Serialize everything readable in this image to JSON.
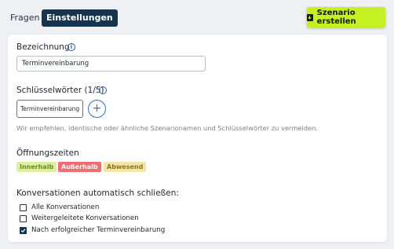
{
  "tabs": {
    "fragen": "Fragen",
    "einstellungen": "Einstellungen"
  },
  "header": {
    "create_button": "Szenario erstellen",
    "create_icon": "download-box-icon"
  },
  "form": {
    "bezeichnung_label": "Bezeichnung",
    "bezeichnung_value": "Terminvereinbarung",
    "keywords_label": "Schlüsselwörter (1/5)",
    "keywords": [
      "Terminvereinbarung"
    ],
    "hint": "Wir empfehlen, identische oder ähnliche Szenarionamen und Schlüsselwörter zu vermeiden.",
    "opening_label": "Öffnungszeiten",
    "opening_badges": {
      "inner": "Innerhalb",
      "outer": "Außerhalb",
      "away": "Abwesend"
    },
    "close_label": "Konversationen automatisch schließen:",
    "close_options": [
      {
        "label": "Alle Konversationen",
        "checked": false
      },
      {
        "label": "Weitergeleitete Konversationen",
        "checked": false
      },
      {
        "label": "Nach erfolgreicher Terminvereinbarung",
        "checked": true
      }
    ]
  },
  "colors": {
    "accent_dark": "#17344f",
    "accent_lime": "#c5f021",
    "badge_inner": "#dcefa4",
    "badge_outer": "#ec6f6f",
    "badge_away": "#f6e5a8"
  }
}
